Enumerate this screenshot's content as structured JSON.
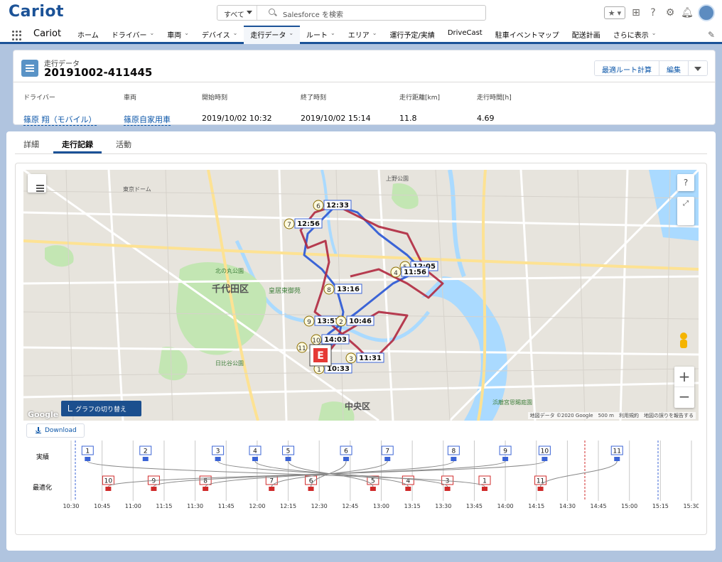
{
  "topbar": {
    "logo": "Cariot",
    "search_scope": "すべて",
    "search_placeholder": "Salesforce を検索"
  },
  "nav": {
    "app_name": "Cariot",
    "items": [
      {
        "label": "ホーム",
        "chevron": false
      },
      {
        "label": "ドライバー",
        "chevron": true
      },
      {
        "label": "車両",
        "chevron": true
      },
      {
        "label": "デバイス",
        "chevron": true
      },
      {
        "label": "走行データ",
        "chevron": true,
        "active": true
      },
      {
        "label": "ルート",
        "chevron": true
      },
      {
        "label": "エリア",
        "chevron": true
      },
      {
        "label": "運行予定/実績",
        "chevron": false
      },
      {
        "label": "DriveCast",
        "chevron": false
      },
      {
        "label": "駐車イベントマップ",
        "chevron": false
      },
      {
        "label": "配送計画",
        "chevron": false
      },
      {
        "label": "さらに表示",
        "chevron": true
      }
    ]
  },
  "record": {
    "object_type": "走行データ",
    "name": "20191002-411445",
    "buttons": {
      "optimize": "最適ルート計算",
      "edit": "編集"
    },
    "fields": [
      {
        "label": "ドライバー",
        "value": "篠原 翔（モバイル）",
        "link": true
      },
      {
        "label": "車両",
        "value": "篠原自家用車",
        "link": true
      },
      {
        "label": "開始時刻",
        "value": "2019/10/02 10:32",
        "link": false
      },
      {
        "label": "終了時刻",
        "value": "2019/10/02 15:14",
        "link": false
      },
      {
        "label": "走行距離[km]",
        "value": "11.8",
        "link": false
      },
      {
        "label": "走行時間[h]",
        "value": "4.69",
        "link": false
      }
    ]
  },
  "tabs": [
    {
      "label": "詳細",
      "active": false
    },
    {
      "label": "走行記録",
      "active": true
    },
    {
      "label": "活動",
      "active": false
    }
  ],
  "map": {
    "graph_toggle_label": "グラフの切り替え",
    "help": "?",
    "zoom_in": "+",
    "zoom_out": "−",
    "credit": "地図データ ©2020 Google　500 m　利用規約　地図の誤りを報告する",
    "google": "Google",
    "place_labels": [
      {
        "text": "千代田区"
      },
      {
        "text": "中央区"
      },
      {
        "text": "皇居東御苑"
      },
      {
        "text": "北の丸公園"
      },
      {
        "text": "日比谷公園"
      },
      {
        "text": "浜離宮恩賜庭園"
      },
      {
        "text": "東京ドーム"
      },
      {
        "text": "上野公園"
      }
    ],
    "stops": [
      {
        "num": "6",
        "time": "12:33"
      },
      {
        "num": "7",
        "time": "12:56"
      },
      {
        "num": "5",
        "time": "12:05"
      },
      {
        "num": "4",
        "time": "11:56"
      },
      {
        "num": "8",
        "time": "13:16"
      },
      {
        "num": "9",
        "time": "13:57"
      },
      {
        "num": "2",
        "time": "10:46"
      },
      {
        "num": "10",
        "time": "14:03"
      },
      {
        "num": "3",
        "time": "11:31"
      },
      {
        "num": "1",
        "time": "10:33"
      },
      {
        "num": "11",
        "time": ""
      }
    ],
    "end_marker": "E"
  },
  "download_label": "Download",
  "chart_data": {
    "type": "timeline",
    "rows": [
      "実績",
      "最適化"
    ],
    "x_ticks": [
      "10:30",
      "10:45",
      "11:00",
      "11:15",
      "11:30",
      "11:45",
      "12:00",
      "12:15",
      "12:30",
      "12:45",
      "13:00",
      "13:15",
      "13:30",
      "13:45",
      "14:00",
      "14:15",
      "14:30",
      "14:45",
      "15:00",
      "15:15",
      "15:30"
    ],
    "x_range": [
      "10:30",
      "15:30"
    ],
    "series": [
      {
        "name": "実績",
        "color": "#3b64d6",
        "stops": [
          {
            "label": "1",
            "time": "10:38"
          },
          {
            "label": "2",
            "time": "11:06"
          },
          {
            "label": "3",
            "time": "11:41"
          },
          {
            "label": "4",
            "time": "11:59"
          },
          {
            "label": "5",
            "time": "12:15"
          },
          {
            "label": "6",
            "time": "12:43"
          },
          {
            "label": "7",
            "time": "13:03"
          },
          {
            "label": "8",
            "time": "13:35"
          },
          {
            "label": "9",
            "time": "14:00"
          },
          {
            "label": "10",
            "time": "14:19"
          },
          {
            "label": "11",
            "time": "14:54"
          }
        ]
      },
      {
        "name": "最適化",
        "color": "#d02a2a",
        "stops": [
          {
            "label": "10",
            "time": "10:48"
          },
          {
            "label": "9",
            "time": "11:10"
          },
          {
            "label": "8",
            "time": "11:35"
          },
          {
            "label": "7",
            "time": "12:07"
          },
          {
            "label": "6",
            "time": "12:26"
          },
          {
            "label": "5",
            "time": "12:56"
          },
          {
            "label": "4",
            "time": "13:13"
          },
          {
            "label": "3",
            "time": "13:32"
          },
          {
            "label": "1",
            "time": "13:50"
          },
          {
            "label": "11",
            "time": "14:17"
          }
        ]
      }
    ]
  }
}
